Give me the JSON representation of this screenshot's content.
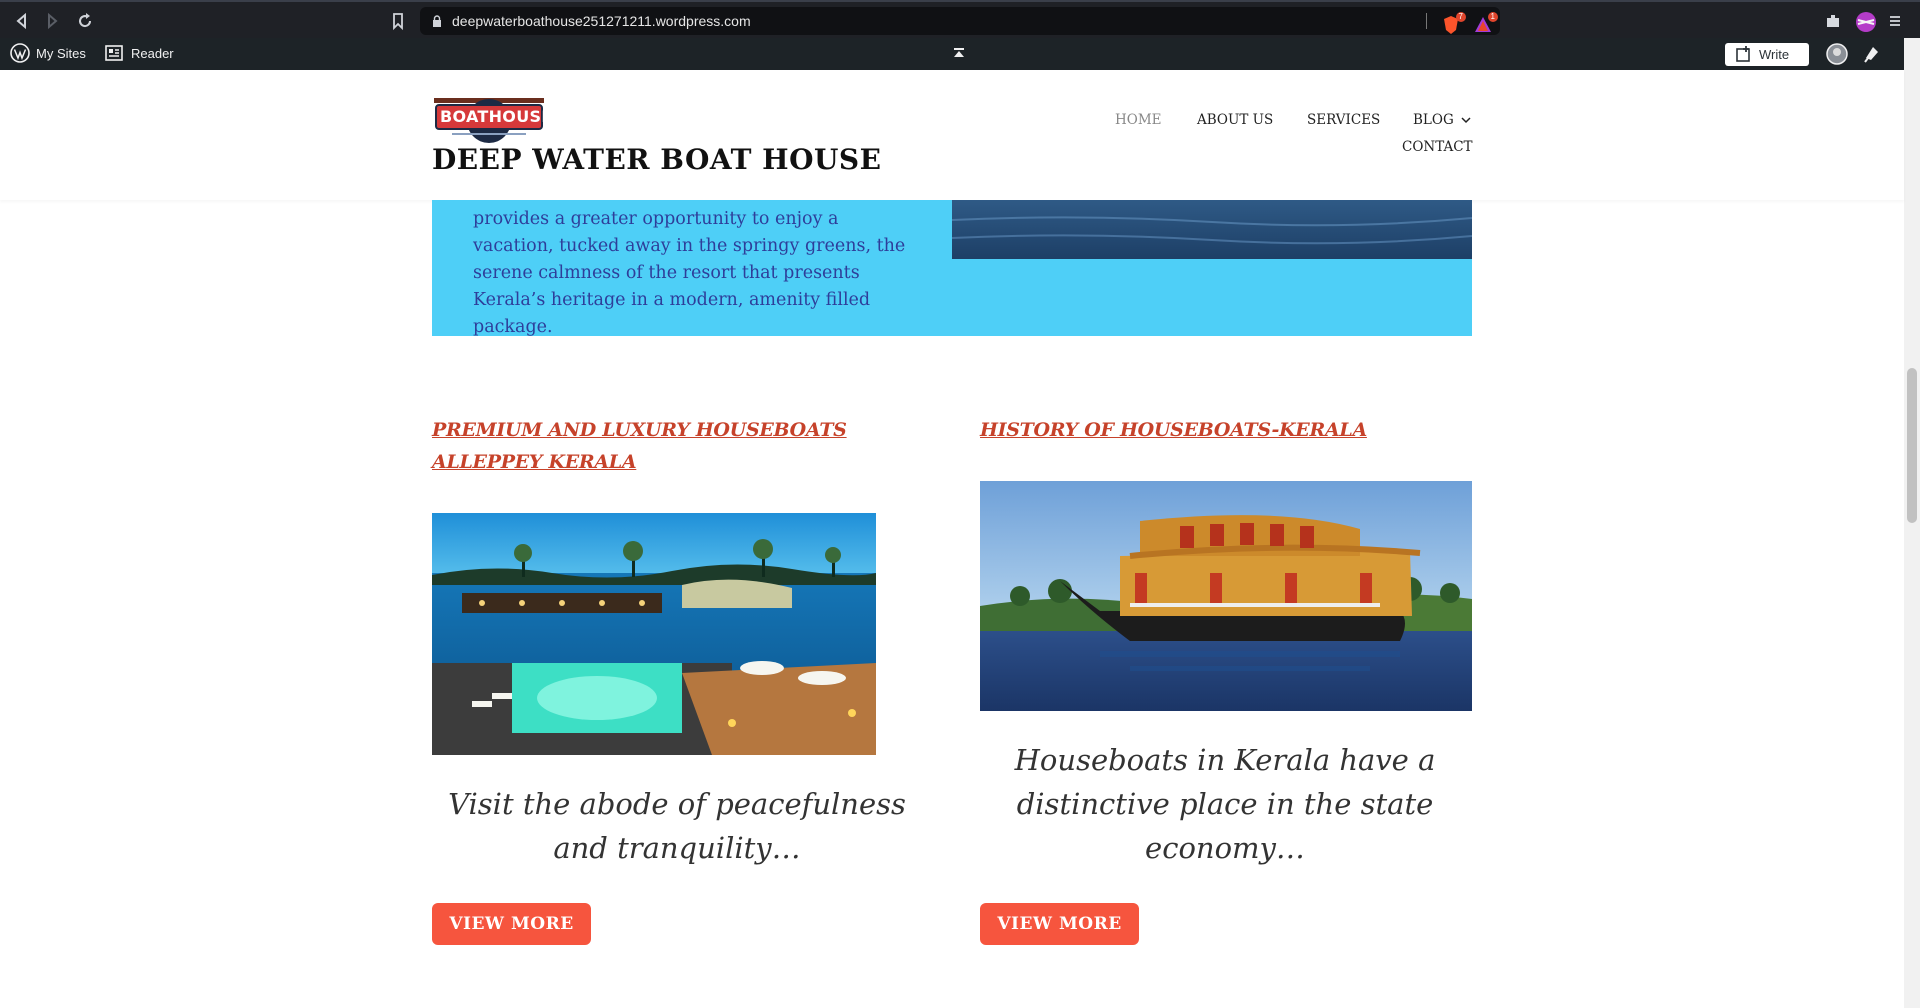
{
  "browser": {
    "url": "deepwaterboathouse251271211.wordpress.com",
    "shield_badge": "7",
    "alert_badge": "1"
  },
  "admin_bar": {
    "my_sites": "My Sites",
    "reader": "Reader",
    "write": "Write"
  },
  "site": {
    "logo_text": "BOATHOUSE",
    "title": "DEEP WATER BOAT HOUSE",
    "menu": {
      "home": "HOME",
      "about": "ABOUT US",
      "services": "SERVICES",
      "blog": "BLOG",
      "contact": "CONTACT"
    }
  },
  "hero": {
    "text": "provides a greater opportunity to enjoy a vacation, tucked away in the springy greens, the serene calmness of the resort that presents Kerala’s heritage in a modern, amenity filled package."
  },
  "posts": [
    {
      "title": "PREMIUM AND LUXURY HOUSEBOATS ALLEPPEY KERALA",
      "excerpt": "Visit the abode of peacefulness and tranquility…",
      "button": "VIEW MORE"
    },
    {
      "title": "HISTORY OF HOUSEBOATS-KERALA",
      "excerpt": "Houseboats in Kerala have a distinctive place in the state economy…",
      "button": "VIEW MORE"
    }
  ],
  "colors": {
    "accent": "#f6553e",
    "hero_bg": "#4ecff7",
    "hero_text": "#2e3e9a",
    "post_title": "#c6422a"
  }
}
